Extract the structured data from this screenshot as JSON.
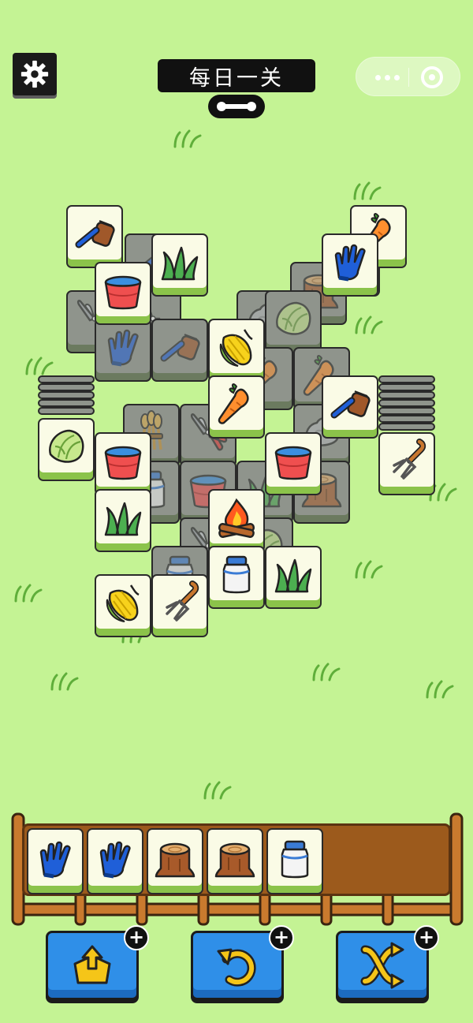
{
  "header": {
    "title": "每日一关",
    "settings_icon": "gear-icon",
    "progress_icon": "level-progress-knob",
    "capsule": {
      "more_icon": "more-dots-icon",
      "close_icon": "mini-program-close-icon"
    }
  },
  "board": {
    "tiles": [
      {
        "item": "brush",
        "state": "dim"
      },
      {
        "item": "stump",
        "state": "dim"
      },
      {
        "item": "milk",
        "state": "dim"
      },
      {
        "item": "gloves",
        "state": "dim"
      },
      {
        "item": "pruner",
        "state": "dim"
      },
      {
        "item": "stone",
        "state": "dim"
      },
      {
        "item": "pruner",
        "state": "dim"
      },
      {
        "item": "cabbage",
        "state": "dim"
      },
      {
        "item": "gloves",
        "state": "dim"
      },
      {
        "item": "brush",
        "state": "dim"
      },
      {
        "item": "carrot",
        "state": "dim"
      },
      {
        "item": "carrot",
        "state": "dim"
      },
      {
        "item": "wheat",
        "state": "dim"
      },
      {
        "item": "pruner",
        "state": "dim"
      },
      {
        "item": "stone",
        "state": "dim"
      },
      {
        "item": "milk",
        "state": "dim"
      },
      {
        "item": "bucket",
        "state": "dim"
      },
      {
        "item": "grass",
        "state": "dim"
      },
      {
        "item": "stump",
        "state": "dim"
      },
      {
        "item": "pruner",
        "state": "dim"
      },
      {
        "item": "cabbage",
        "state": "dim"
      },
      {
        "item": "milk",
        "state": "dim"
      },
      {
        "item": "brush",
        "state": "active"
      },
      {
        "item": "grass",
        "state": "active"
      },
      {
        "item": "carrot",
        "state": "active"
      },
      {
        "item": "gloves",
        "state": "active"
      },
      {
        "item": "bucket",
        "state": "active"
      },
      {
        "item": "corn",
        "state": "active"
      },
      {
        "item": "carrot",
        "state": "active"
      },
      {
        "item": "brush",
        "state": "active"
      },
      {
        "item": "cabbage",
        "state": "active"
      },
      {
        "item": "bucket",
        "state": "active"
      },
      {
        "item": "bucket",
        "state": "active"
      },
      {
        "item": "fork",
        "state": "active"
      },
      {
        "item": "grass",
        "state": "active"
      },
      {
        "item": "campfire",
        "state": "active"
      },
      {
        "item": "milk",
        "state": "active"
      },
      {
        "item": "grass",
        "state": "active"
      },
      {
        "item": "corn",
        "state": "active"
      },
      {
        "item": "fork",
        "state": "active"
      }
    ]
  },
  "tray": {
    "slots": [
      "gloves",
      "gloves",
      "stump",
      "stump",
      "milk"
    ],
    "capacity": 7
  },
  "tools": [
    {
      "name": "move-out",
      "icon": "move-out-icon",
      "add_icon": "plus-icon"
    },
    {
      "name": "undo",
      "icon": "undo-icon",
      "add_icon": "plus-icon"
    },
    {
      "name": "shuffle",
      "icon": "shuffle-icon",
      "add_icon": "plus-icon"
    }
  ],
  "colors": {
    "background": "#c4f394",
    "tile_face": "#fafbe6",
    "tile_base": "#8bc34a",
    "tile_dim": "#8f948c",
    "tool_button": "#2f8fe8",
    "tray_wood": "#9c5a1c"
  }
}
